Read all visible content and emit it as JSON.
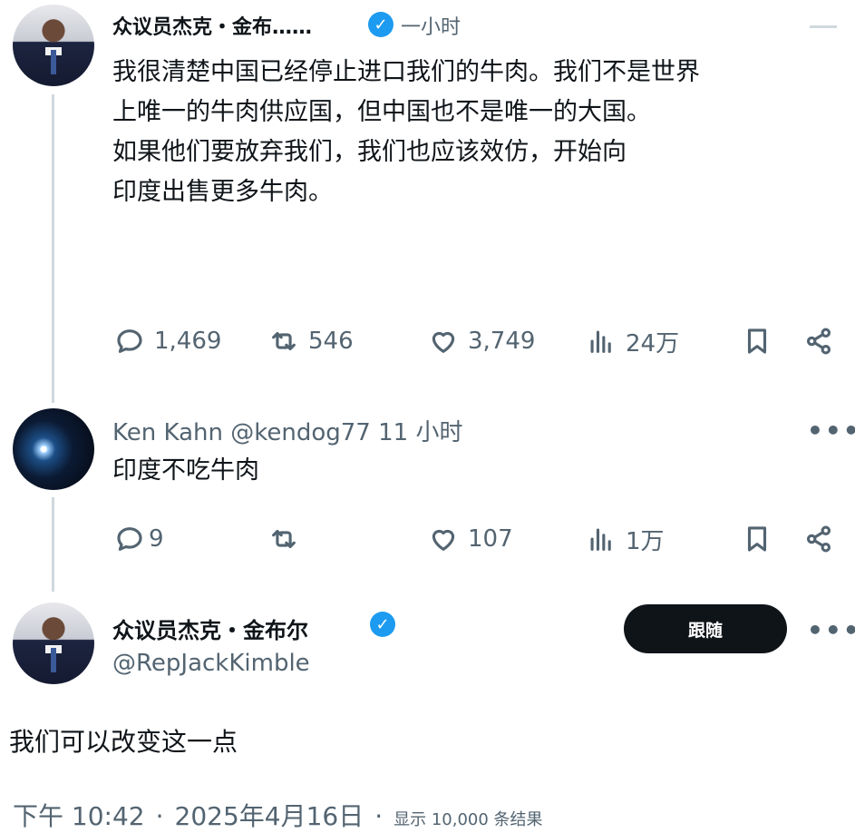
{
  "tweet1": {
    "name": "众议员杰克・金布……",
    "time": "一小时",
    "text_lines": [
      "我很清楚中国已经停止进口我们的牛肉。我们不是世界",
      "上唯一的牛肉供应国，但中国也不是唯一的大国。",
      "如果他们要放弃我们，我们也应该效仿，开始向",
      "印度出售更多牛肉。"
    ],
    "stats": {
      "replies": "1,469",
      "retweets": "546",
      "likes": "3,749",
      "views": "24万"
    }
  },
  "tweet2": {
    "name": "Ken Kahn",
    "handle": "@kendog77",
    "time": "11 小时",
    "text": "印度不吃牛肉",
    "stats": {
      "replies": "9",
      "retweets": "",
      "likes": "107",
      "views": "1万"
    }
  },
  "tweet3": {
    "name": "众议员杰克・金布尔",
    "handle": "@RepJackKimble",
    "follow_label": "跟随",
    "text": "我们可以改变这一点",
    "time": "下午 10:42",
    "date": "2025年4月16日",
    "views": "显示 10,000 条结果"
  },
  "verified_symbol": "✓",
  "more_symbol": "•••",
  "separator": "·",
  "colors": {
    "accent": "#1d9bf0",
    "text": "#0f1419",
    "muted": "#536471",
    "line": "#cfd9de"
  }
}
